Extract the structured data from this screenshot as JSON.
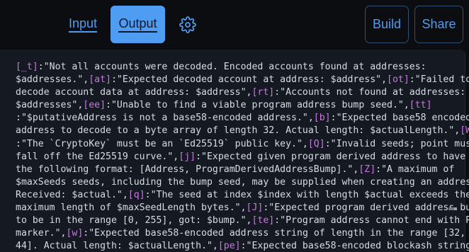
{
  "tabs": {
    "input_label": "Input",
    "output_label": "Output"
  },
  "actions": {
    "build_label": "Build",
    "share_label": "Share"
  },
  "icons": {
    "settings": "gear-icon"
  },
  "colors": {
    "accent": "#4f9df2",
    "background": "#0b0d10",
    "panel": "#151a22",
    "key": "#c678dd",
    "text": "#d7dce3"
  },
  "output": {
    "lines": [
      [
        {
          "k": "[_t]"
        },
        {
          "t": ":\"Not all accounts were decoded. Encoded accounts found at addresses:"
        }
      ],
      [
        {
          "t": "$addresses.\","
        },
        {
          "k": "[at]"
        },
        {
          "t": ":\"Expected decoded account at address: $address\","
        },
        {
          "k": "[ot]"
        },
        {
          "t": ":\"Failed to"
        }
      ],
      [
        {
          "t": "decode account data at address: $address\","
        },
        {
          "k": "[rt]"
        },
        {
          "t": ":\"Accounts not found at addresses:"
        }
      ],
      [
        {
          "t": "$addresses\","
        },
        {
          "k": "[ee]"
        },
        {
          "t": ":\"Unable to find a viable program address bump seed.\","
        },
        {
          "k": "[tt]"
        }
      ],
      [
        {
          "t": ":\"$putativeAddress is not a base58-encoded address.\","
        },
        {
          "k": "[b]"
        },
        {
          "t": ":\"Expected base58 encoded"
        }
      ],
      [
        {
          "t": "address to decode to a byte array of length 32. Actual length: $actualLength.\","
        },
        {
          "k": "[W]"
        }
      ],
      [
        {
          "t": ":\"The `CryptoKey` must be an `Ed25519` public key.\","
        },
        {
          "k": "[Q]"
        },
        {
          "t": ":\"Invalid seeds; point must"
        }
      ],
      [
        {
          "t": "fall off the Ed25519 curve.\","
        },
        {
          "k": "[j]"
        },
        {
          "t": ":\"Expected given program derived address to have"
        }
      ],
      [
        {
          "t": "the following format: [Address, ProgramDerivedAddressBump].\","
        },
        {
          "k": "[Z]"
        },
        {
          "t": ":\"A maximum of"
        }
      ],
      [
        {
          "t": "$maxSeeds seeds, including the bump seed, may be supplied when creating an address."
        }
      ],
      [
        {
          "t": "Received: $actual.\","
        },
        {
          "k": "[q]"
        },
        {
          "t": ":\"The seed at index $index with length $actual exceeds the"
        }
      ],
      [
        {
          "t": "maximum length of $maxSeedLength bytes.\","
        },
        {
          "k": "[J]"
        },
        {
          "t": ":\"Expected program derived address bump"
        }
      ],
      [
        {
          "t": "to be in the range [0, 255], got: $bump.\","
        },
        {
          "k": "[te]"
        },
        {
          "t": ":\"Program address cannot end with PDA"
        }
      ],
      [
        {
          "t": "marker.\","
        },
        {
          "k": "[w]"
        },
        {
          "t": ":\"Expected base58-encoded address string of length in the range [32,"
        }
      ],
      [
        {
          "t": "44]. Actual length: $actualLength.\","
        },
        {
          "k": "[pe]"
        },
        {
          "t": ":\"Expected base58-encoded blockash string"
        }
      ]
    ]
  }
}
